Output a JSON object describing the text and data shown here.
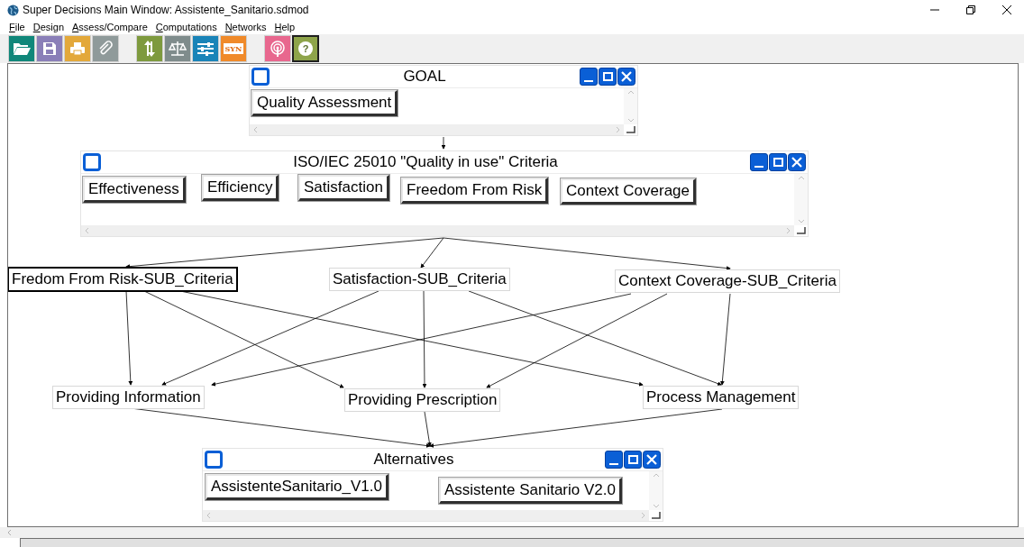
{
  "window": {
    "title": "Super Decisions Main Window: Assistente_Sanitario.sdmod"
  },
  "menu": [
    {
      "label": "File"
    },
    {
      "label": "Design"
    },
    {
      "label": "Assess/Compare"
    },
    {
      "label": "Computations"
    },
    {
      "label": "Networks"
    },
    {
      "label": "Help"
    }
  ],
  "toolbar": [
    {
      "kind": "open",
      "color": "#10877a",
      "pressed": false
    },
    {
      "kind": "save",
      "color": "#8a7fb8",
      "pressed": false
    },
    {
      "kind": "print",
      "color": "#e3a83a",
      "pressed": false
    },
    {
      "kind": "attach",
      "color": "#8f9a9a",
      "pressed": false
    },
    {
      "kind": "update",
      "color": "#7e9a3e",
      "pressed": false
    },
    {
      "kind": "scales",
      "color": "#7f8c8c",
      "pressed": false
    },
    {
      "kind": "sliders",
      "color": "#1a84b8",
      "pressed": false
    },
    {
      "kind": "syn",
      "color": "#f08a2a",
      "label": "SYN",
      "pressed": false
    },
    {
      "kind": "broadcast",
      "color": "#e8678e",
      "pressed": false
    },
    {
      "kind": "help",
      "color": "#8ea44a",
      "label": "?",
      "pressed": true
    }
  ],
  "clusters": [
    {
      "name": "GOAL",
      "nodes": [
        {
          "label": "Quality Assessment"
        }
      ]
    },
    {
      "name": "ISO/IEC 25010 \"Quality in use\" Criteria",
      "nodes": [
        {
          "label": "Effectiveness"
        },
        {
          "label": "Efficiency"
        },
        {
          "label": "Satisfaction"
        },
        {
          "label": "Freedom From Risk"
        },
        {
          "label": "Context Coverage"
        }
      ]
    },
    {
      "name": "Alternatives",
      "nodes": [
        {
          "label": "AssistenteSanitario_V1.0"
        },
        {
          "label": "Assistente Sanitario V2.0"
        }
      ]
    }
  ],
  "free_nodes": [
    {
      "label": "Fredom From Risk-SUB_Criteria",
      "selected": true
    },
    {
      "label": "Satisfaction-SUB_Criteria",
      "selected": false
    },
    {
      "label": "Context Coverage-SUB_Criteria",
      "selected": false
    },
    {
      "label": "Providing Information",
      "selected": false
    },
    {
      "label": "Providing Prescription",
      "selected": false
    },
    {
      "label": "Process Management",
      "selected": false
    }
  ]
}
